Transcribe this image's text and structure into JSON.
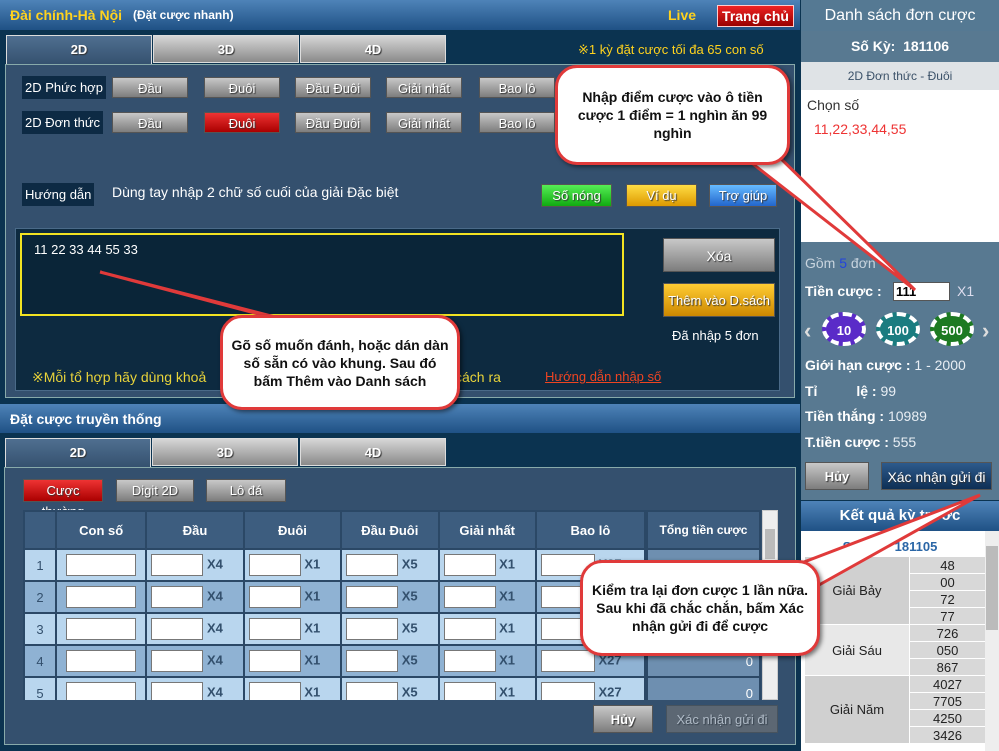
{
  "quick": {
    "title": "Đài chính-Hà Nội",
    "subtitle": "(Đặt cược nhanh)",
    "live": "Live",
    "home": "Trang chủ",
    "tabs": [
      "2D",
      "3D",
      "4D"
    ],
    "limit_note": "※1 kỳ đặt cược tối đa 65 con số",
    "rows": [
      {
        "label": "2D Phức hợp",
        "buttons": [
          "Đầu",
          "Đuôi",
          "Đầu Đuôi",
          "Giải nhất",
          "Bao lô"
        ]
      },
      {
        "label": "2D Đơn thức",
        "buttons": [
          "Đầu",
          "Đuôi",
          "Đầu Đuôi",
          "Giải nhất",
          "Bao lô"
        ],
        "active": "Đuôi"
      }
    ],
    "guide_label": "Hướng dẫn",
    "guide_text": "Dùng tay nhập 2 chữ số cuối của giải Đặc biệt",
    "hot": "Số nóng",
    "example": "Ví dụ",
    "help": "Trợ giúp",
    "input_value": "11 22 33 44 55 33",
    "clear": "Xóa",
    "add": "Thêm vào D.sách",
    "entered": "Đã nhập 5 đơn",
    "hint_a": "※Mỗi tổ hợp hãy dùng khoả",
    "hint_b": "cách ra",
    "input_guide": "Hướng dẫn nhập số"
  },
  "traditional": {
    "title": "Đặt cược truyền thống",
    "tabs": [
      "2D",
      "3D",
      "4D"
    ],
    "modes": [
      "Cược thường",
      "Digit 2D",
      "Lô đá"
    ],
    "columns": [
      "",
      "Con số",
      "Đầu",
      "Đuôi",
      "Đầu Đuôi",
      "Giải nhất",
      "Bao lô",
      "",
      "Tổng tiền cược"
    ],
    "multipliers": [
      "X4",
      "X1",
      "X5",
      "X1",
      "X27"
    ],
    "rows": [
      {
        "n": "1",
        "total": ""
      },
      {
        "n": "2",
        "total": ""
      },
      {
        "n": "3",
        "total": ""
      },
      {
        "n": "4",
        "total": "0"
      },
      {
        "n": "5",
        "total": "0"
      }
    ],
    "cancel": "Hủy",
    "confirm": "Xác nhận gửi đi"
  },
  "orders": {
    "title": "Danh sách đơn cược",
    "period_label": "Số Kỳ:",
    "period": "181106",
    "type": "2D Đơn thức - Đuôi",
    "choose_label": "Chọn số",
    "numbers": "11,22,33,44,55",
    "count_pre": "Gồm",
    "count": "5",
    "count_post": "đơn",
    "stake_label": "Tiền cược :",
    "stake": "111",
    "mult": "X1",
    "chips": [
      "10",
      "100",
      "500"
    ],
    "limit_label": "Giới hạn cược :",
    "limit": "1 - 2000",
    "rate_label": "Tỉ          lệ :",
    "rate": "99",
    "win_label": "Tiền thắng :",
    "win": "10989",
    "total_label": "T.tiền cược :",
    "total": "555",
    "cancel": "Hủy",
    "confirm": "Xác nhận gửi đi"
  },
  "previous": {
    "title": "Kết quả kỳ trước",
    "period_label": "Số Kỳ:",
    "period": "181105",
    "prizes": [
      {
        "name": "Giải Bảy",
        "values": [
          "48",
          "00",
          "72",
          "77"
        ]
      },
      {
        "name": "Giải Sáu",
        "values": [
          "726",
          "050",
          "867"
        ]
      },
      {
        "name": "Giải Năm",
        "values": [
          "4027",
          "7705",
          "4250",
          "3426"
        ]
      }
    ]
  },
  "callouts": {
    "stake": "Nhập điểm cược vào ô tiền cược 1 điểm = 1 nghìn ăn 99 nghìn",
    "input": "Gõ số muốn đánh, hoặc dán dàn số sẵn có vào khung. Sau đó bấm Thêm vào Danh sách",
    "confirm": "Kiểm tra lại đơn cược 1 lần nữa. Sau khi đã chắc chắn, bấm Xác nhận gửi đi để cược"
  },
  "colors": {
    "accent_yellow": "#ffd21e",
    "active_red": "#d41c1c",
    "callout_border": "#e03a3a"
  }
}
